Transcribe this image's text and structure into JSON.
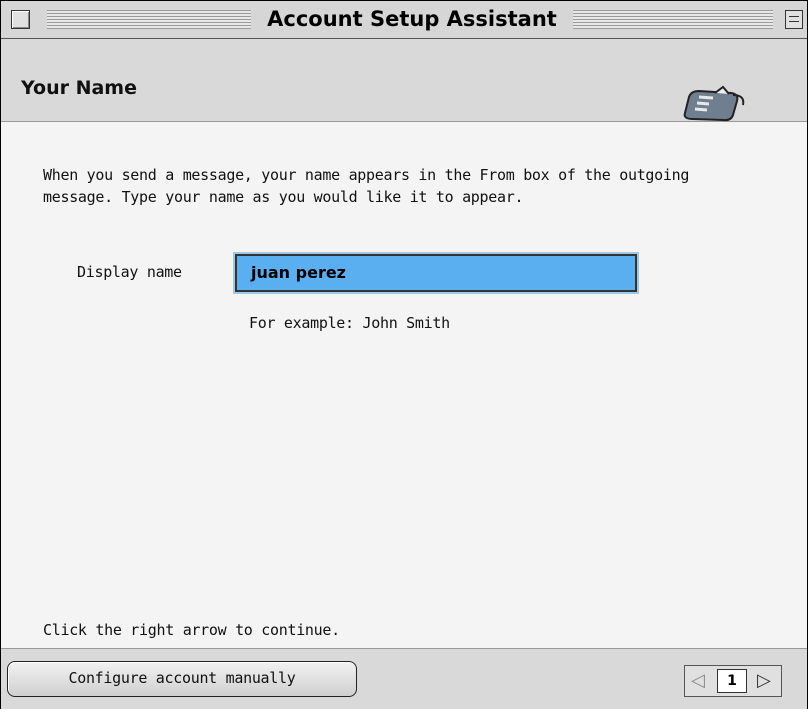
{
  "window": {
    "title": "Account Setup Assistant"
  },
  "header": {
    "title": "Your Name",
    "icon": "mail-envelope-icon"
  },
  "content": {
    "description": "When you send a message, your name appears in the From box of the outgoing message. Type your name as you would like it to appear.",
    "display_name_label": "Display name",
    "display_name_value": "juan perez",
    "example_text": "For example: John Smith",
    "continue_hint": "Click the right arrow to continue."
  },
  "footer": {
    "configure_button": "Configure account manually",
    "page_number": "1",
    "prev_icon": "left-arrow-icon",
    "next_icon": "right-arrow-icon"
  },
  "colors": {
    "input_highlight": "#5aaff0",
    "background": "#f4f4f4"
  }
}
